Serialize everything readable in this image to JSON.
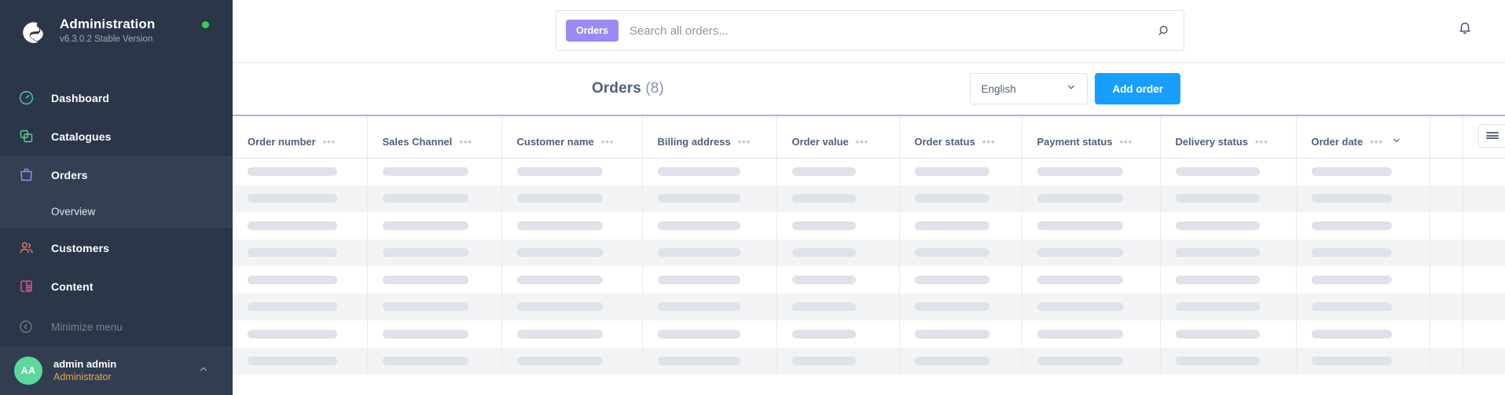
{
  "sidebar": {
    "brand": {
      "title": "Administration",
      "version": "v6.3.0.2 Stable Version",
      "logo_icon": "shopware-logo-icon",
      "status_dot_color": "#37d058"
    },
    "items": [
      {
        "label": "Dashboard",
        "icon": "speedometer-icon",
        "color": "#4fc3d4",
        "active": false
      },
      {
        "label": "Catalogues",
        "icon": "layers-icon",
        "color": "#5ad18d",
        "active": false
      },
      {
        "label": "Orders",
        "icon": "bag-icon",
        "color": "#9c8cf0",
        "active": true
      },
      {
        "label": "Customers",
        "icon": "users-icon",
        "color": "#e8815a",
        "active": false
      },
      {
        "label": "Content",
        "icon": "content-icon",
        "color": "#e8558f",
        "active": false
      }
    ],
    "sub_items": [
      {
        "label": "Overview",
        "parent": "Orders"
      }
    ],
    "minimize": {
      "label": "Minimize menu",
      "icon": "chevron-left-circle-icon"
    },
    "user": {
      "initials": "AA",
      "name": "admin admin",
      "role": "Administrator",
      "avatar_color": "#5ed79d",
      "caret_icon": "chevron-up-icon"
    }
  },
  "topbar": {
    "search": {
      "badge": "Orders",
      "placeholder": "Search all orders...",
      "value": "",
      "icon": "search-icon"
    },
    "notification_icon": "bell-icon"
  },
  "pagehead": {
    "title": "Orders",
    "count": "(8)",
    "language": {
      "value": "English",
      "caret_icon": "chevron-down-icon"
    },
    "add_button": "Add order"
  },
  "table": {
    "columns": [
      {
        "label": "Order number",
        "menu_icon": "ellipsis-icon",
        "sorted": false
      },
      {
        "label": "Sales Channel",
        "menu_icon": "ellipsis-icon",
        "sorted": false
      },
      {
        "label": "Customer name",
        "menu_icon": "ellipsis-icon",
        "sorted": false
      },
      {
        "label": "Billing address",
        "menu_icon": "ellipsis-icon",
        "sorted": false
      },
      {
        "label": "Order value",
        "menu_icon": "ellipsis-icon",
        "sorted": false
      },
      {
        "label": "Order status",
        "menu_icon": "ellipsis-icon",
        "sorted": false
      },
      {
        "label": "Payment status",
        "menu_icon": "ellipsis-icon",
        "sorted": false
      },
      {
        "label": "Delivery status",
        "menu_icon": "ellipsis-icon",
        "sorted": false
      },
      {
        "label": "Order date",
        "menu_icon": "ellipsis-icon",
        "sorted": true,
        "sort_icon": "chevron-down-icon"
      }
    ],
    "settings_button_icon": "hamburger-icon",
    "loading": true,
    "skeleton_rows": 8,
    "header_accent_color": "#b7abe8"
  }
}
